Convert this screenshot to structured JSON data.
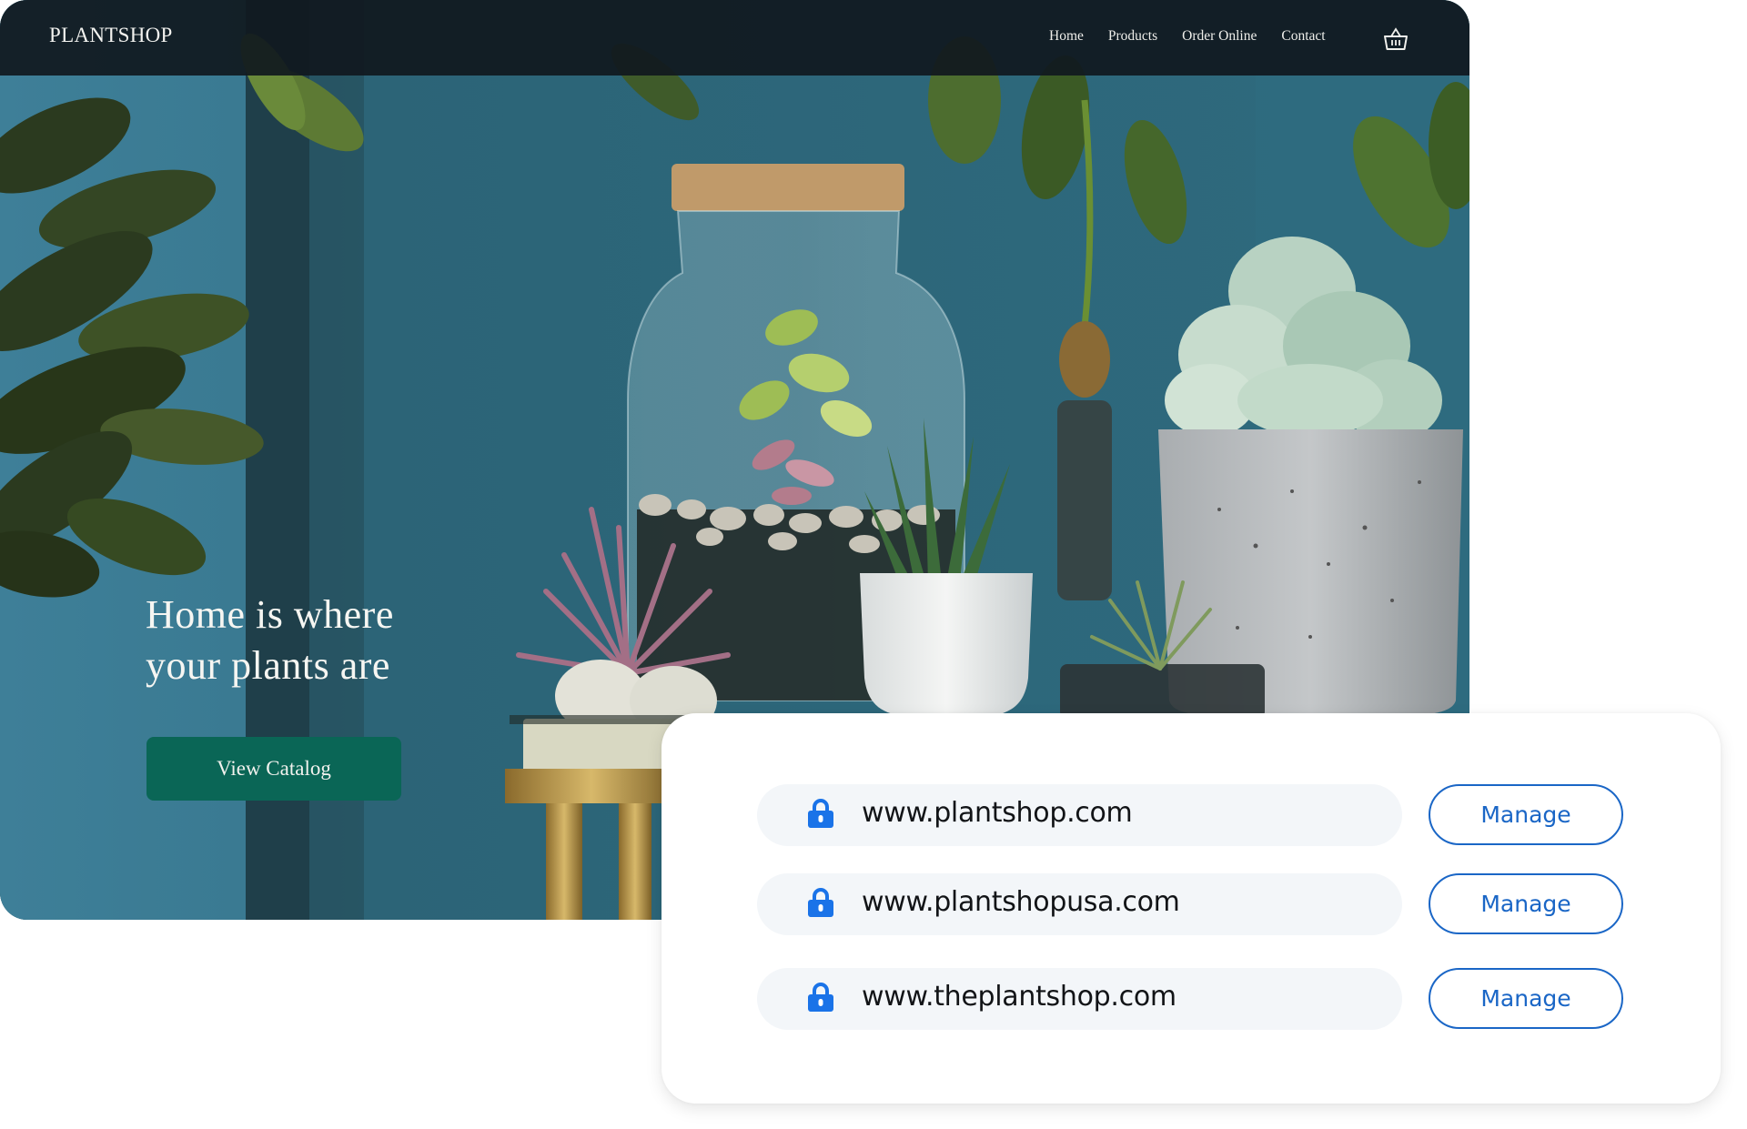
{
  "site": {
    "logo": "PLANTSHOP",
    "nav": [
      {
        "label": "Home"
      },
      {
        "label": "Products"
      },
      {
        "label": "Order Online"
      },
      {
        "label": "Contact"
      }
    ],
    "cart_icon": "shopping-basket-icon"
  },
  "hero": {
    "headline_line1": "Home is where",
    "headline_line2": "your plants are",
    "cta_label": "View Catalog",
    "image_description": "Terrarium jar with cork lid, succulents, aloe, air plants and concrete pot on a marble side table against a teal wall"
  },
  "domains": {
    "items": [
      {
        "domain": "www.plantshop.com",
        "icon": "lock-icon",
        "action": "Manage"
      },
      {
        "domain": "www.plantshopusa.com",
        "icon": "lock-icon",
        "action": "Manage"
      },
      {
        "domain": "www.theplantshop.com",
        "icon": "lock-icon",
        "action": "Manage"
      }
    ]
  },
  "colors": {
    "nav_bg": "#10181e",
    "wall_teal": "#2f6a7f",
    "cta_green": "#0a6656",
    "accent_blue": "#1a66c6",
    "lock_blue": "#1a73e8",
    "pill_bg": "#f3f6f9"
  }
}
